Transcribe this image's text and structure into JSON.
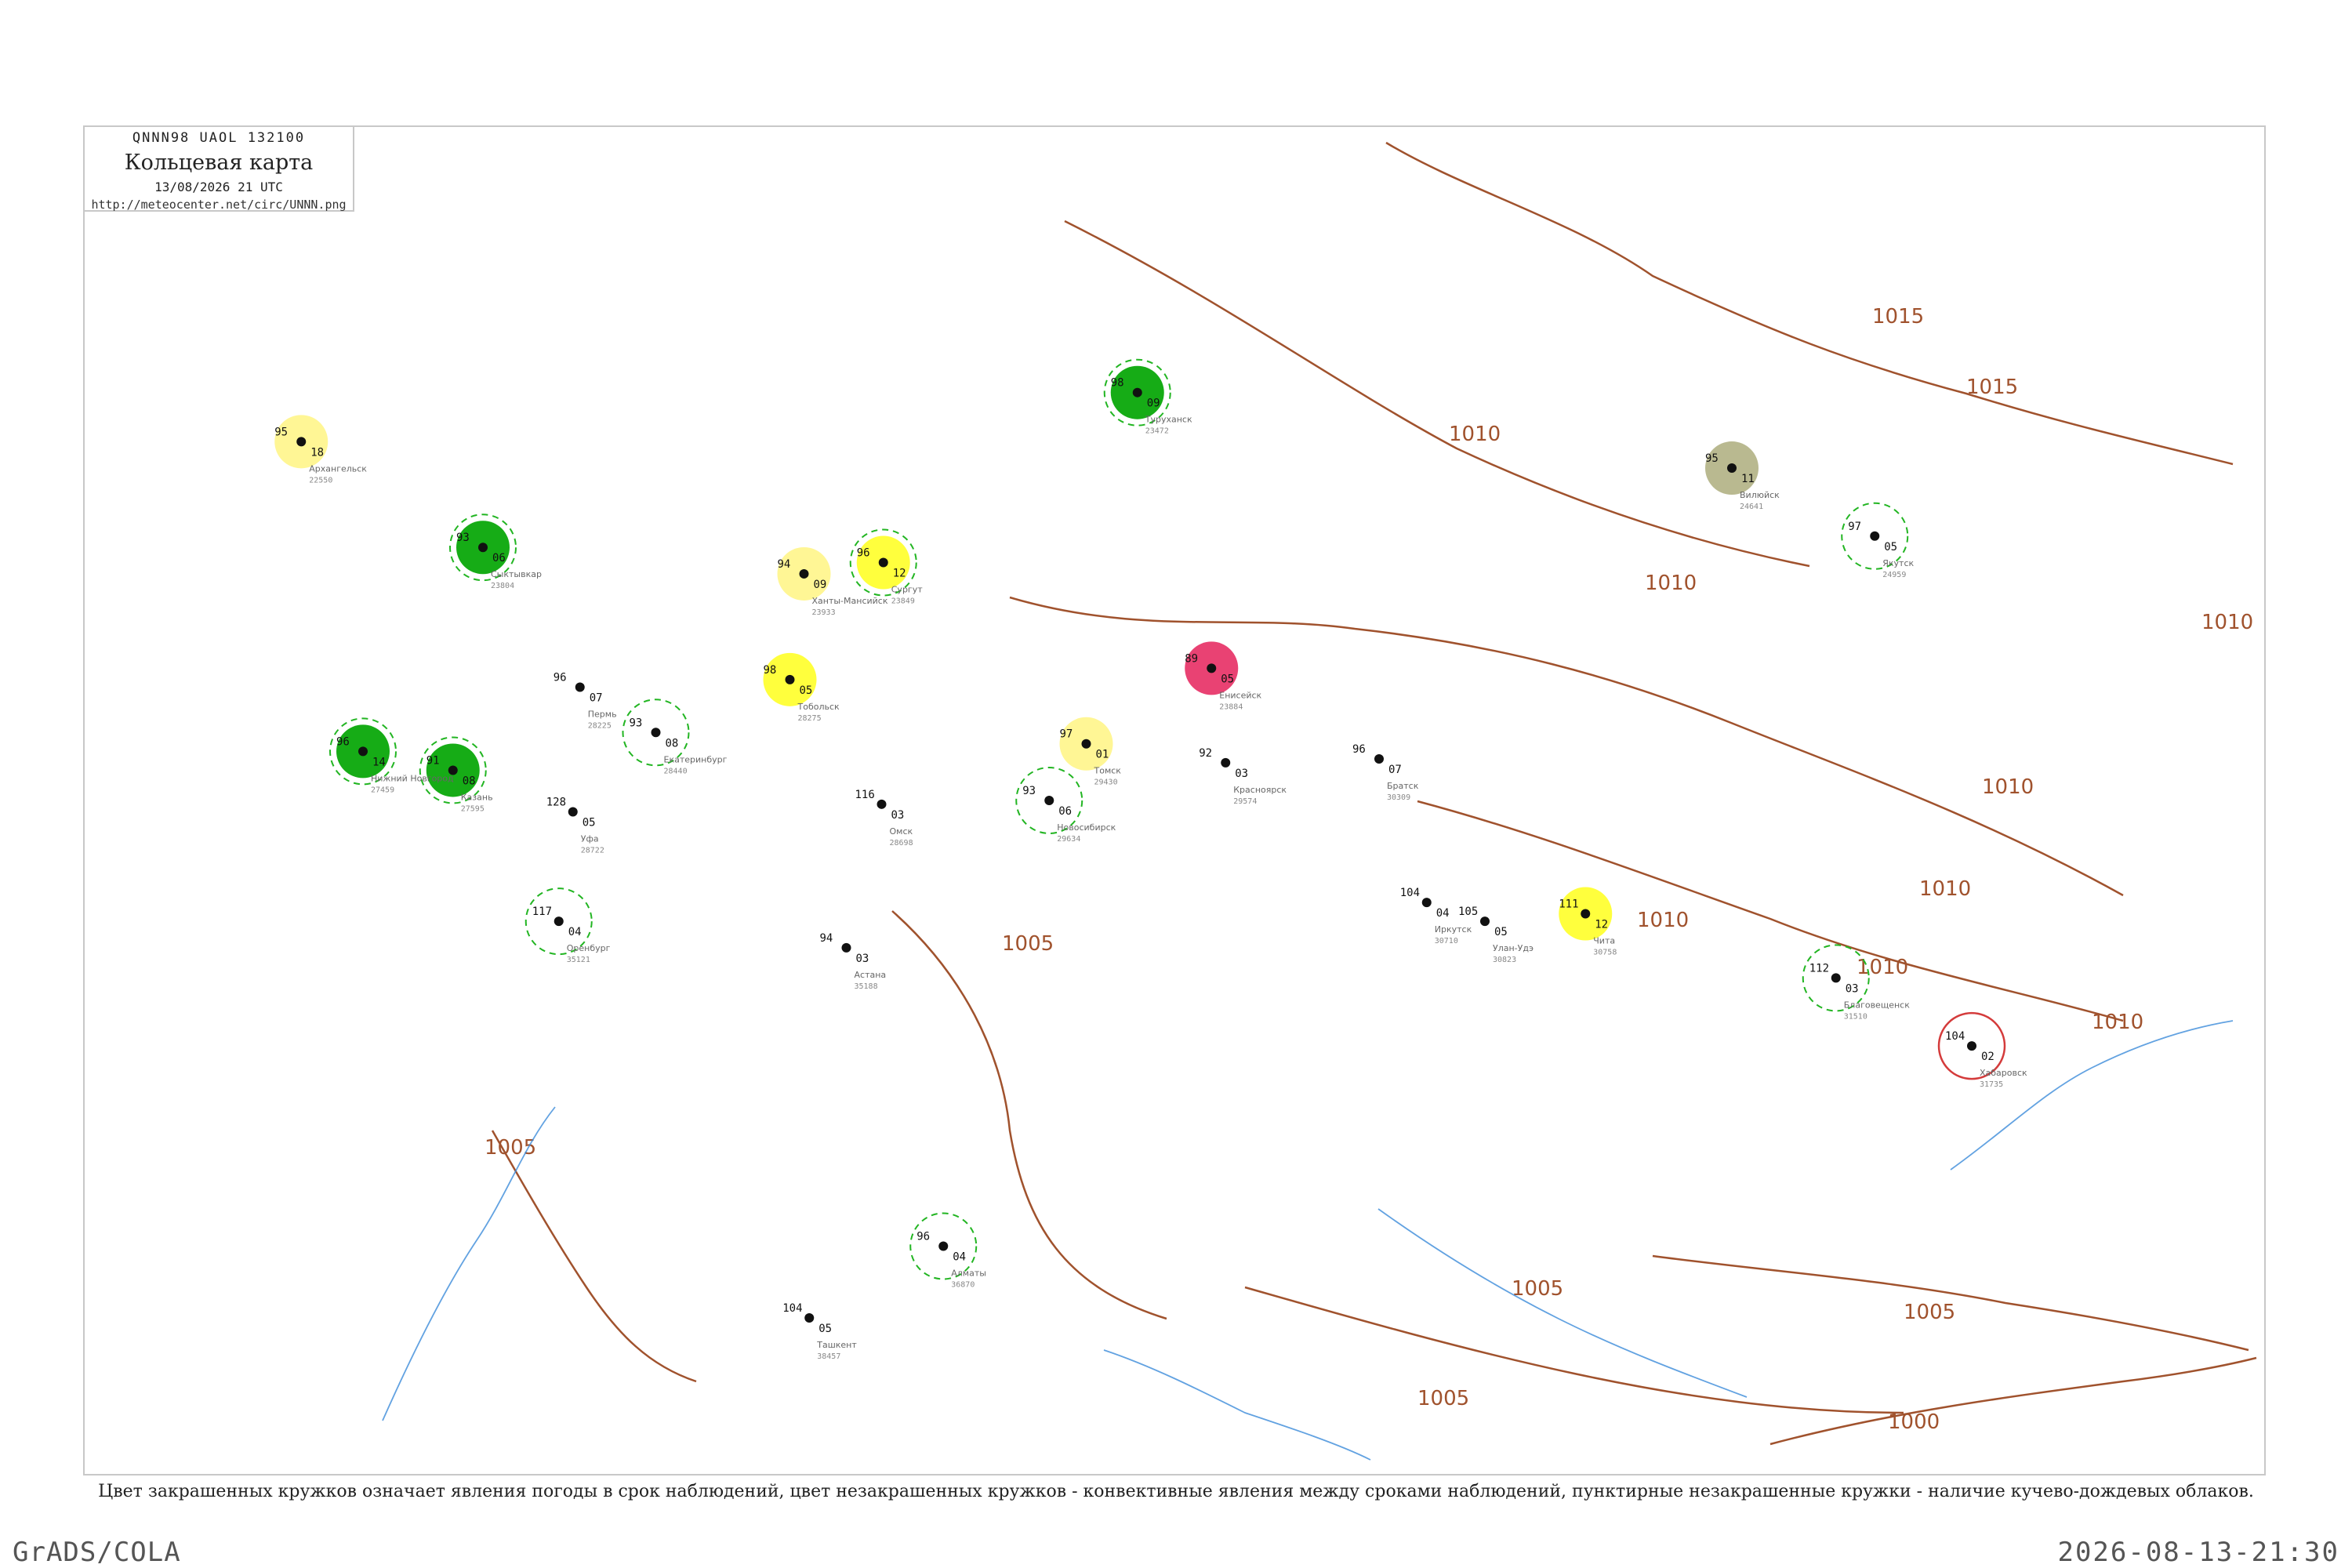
{
  "legend": {
    "code": "QNNN98  UAOL  132100",
    "title": "Кольцевая карта",
    "datetime": "13/08/2026 21 UTC",
    "url": "http://meteocenter.net/circ/UNNN.png"
  },
  "footnote": "Цвет закрашенных кружков означает явления погоды в срок наблюдений, цвет незакрашенных кружков - конвективные явления между сроками наблюдений, пунктирные незакрашенные кружки - наличие кучево-дождевых облаков.",
  "footer": {
    "producer": "GrADS/COLA",
    "timestamp": "2026-08-13-21:30"
  },
  "colors": {
    "isobar": "#a0522d",
    "water": "#3b8bd9",
    "green": "#0aa80a",
    "yellow": "#ffff33",
    "pale_yellow": "#fff68f",
    "pink": "#e8386b",
    "olive": "#b5b58a",
    "dashed_ring": "#22b522",
    "red_ring": "#d43b3b"
  },
  "isobar_labels": [
    "1015",
    "1015",
    "1010",
    "1010",
    "1010",
    "1010",
    "1010",
    "1010",
    "1010",
    "1010",
    "1005",
    "1005",
    "1005",
    "1005",
    "1005",
    "1000"
  ],
  "stations": [
    {
      "name": "Туруханск",
      "id": "23472",
      "lat": 65.8,
      "lon": 87.9,
      "temp": "98",
      "dew": "09",
      "fill": "green",
      "ring": "dashed"
    },
    {
      "name": "Ханты-Мансийск",
      "id": "23933",
      "lat": 61.0,
      "lon": 69.0,
      "temp": "94",
      "dew": "09",
      "fill": "pale_yellow",
      "ring": "none"
    },
    {
      "name": "Сургут",
      "id": "23849",
      "lat": 61.3,
      "lon": 73.5,
      "temp": "96",
      "dew": "12",
      "fill": "yellow",
      "ring": "dashed"
    },
    {
      "name": "Енисейск",
      "id": "23884",
      "lat": 58.5,
      "lon": 92.1,
      "temp": "89",
      "dew": "05",
      "fill": "pink",
      "ring": "none"
    },
    {
      "name": "Вилюйск",
      "id": "24641",
      "lat": 63.8,
      "lon": 121.6,
      "temp": "95",
      "dew": "11",
      "fill": "olive",
      "ring": "none"
    },
    {
      "name": "Якутск",
      "id": "24959",
      "lat": 62.0,
      "lon": 129.7,
      "temp": "97",
      "dew": "05",
      "fill": "none",
      "ring": "dashed"
    },
    {
      "name": "Чита",
      "id": "30758",
      "lat": 52.0,
      "lon": 113.3,
      "temp": "111",
      "dew": "12",
      "fill": "yellow",
      "ring": "none"
    },
    {
      "name": "Хабаровск",
      "id": "31735",
      "lat": 48.5,
      "lon": 135.2,
      "temp": "104",
      "dew": "02",
      "fill": "none",
      "ring": "red"
    },
    {
      "name": "Томск",
      "id": "29430",
      "lat": 56.5,
      "lon": 85.0,
      "temp": "97",
      "dew": "01",
      "fill": "pale_yellow",
      "ring": "none"
    },
    {
      "name": "Новосибирск",
      "id": "29634",
      "lat": 55.0,
      "lon": 82.9,
      "temp": "93",
      "dew": "06",
      "fill": "none",
      "ring": "dashed"
    },
    {
      "name": "Омск",
      "id": "28698",
      "lat": 54.9,
      "lon": 73.4,
      "temp": "116",
      "dew": "03",
      "fill": "none",
      "ring": "none"
    },
    {
      "name": "Тобольск",
      "id": "28275",
      "lat": 58.2,
      "lon": 68.2,
      "temp": "98",
      "dew": "05",
      "fill": "yellow",
      "ring": "none"
    },
    {
      "name": "Пермь",
      "id": "28225",
      "lat": 58.0,
      "lon": 56.3,
      "temp": "96",
      "dew": "07",
      "fill": "none",
      "ring": "none"
    },
    {
      "name": "Екатеринбург",
      "id": "28440",
      "lat": 56.8,
      "lon": 60.6,
      "temp": "93",
      "dew": "08",
      "fill": "none",
      "ring": "dashed"
    },
    {
      "name": "Уфа",
      "id": "28722",
      "lat": 54.7,
      "lon": 55.9,
      "temp": "128",
      "dew": "05",
      "fill": "none",
      "ring": "none"
    },
    {
      "name": "Казань",
      "id": "27595",
      "lat": 55.8,
      "lon": 49.1,
      "temp": "91",
      "dew": "08",
      "fill": "green",
      "ring": "dashed"
    },
    {
      "name": "Нижний Новгород",
      "id": "27459",
      "lat": 56.3,
      "lon": 44.0,
      "temp": "96",
      "dew": "14",
      "fill": "green",
      "ring": "dashed"
    },
    {
      "name": "Сыктывкар",
      "id": "23804",
      "lat": 61.7,
      "lon": 50.8,
      "temp": "93",
      "dew": "06",
      "fill": "green",
      "ring": "dashed"
    },
    {
      "name": "Архангельск",
      "id": "22550",
      "lat": 64.5,
      "lon": 40.5,
      "temp": "95",
      "dew": "18",
      "fill": "pale_yellow",
      "ring": "none"
    },
    {
      "name": "Оренбург",
      "id": "35121",
      "lat": 51.8,
      "lon": 55.1,
      "temp": "117",
      "dew": "04",
      "fill": "none",
      "ring": "dashed"
    },
    {
      "name": "Астана",
      "id": "35188",
      "lat": 51.1,
      "lon": 71.4,
      "temp": "94",
      "dew": "03",
      "fill": "none",
      "ring": "none"
    },
    {
      "name": "Алматы",
      "id": "36870",
      "lat": 43.2,
      "lon": 76.9,
      "temp": "96",
      "dew": "04",
      "fill": "none",
      "ring": "dashed"
    },
    {
      "name": "Ташкент",
      "id": "38457",
      "lat": 41.3,
      "lon": 69.3,
      "temp": "104",
      "dew": "05",
      "fill": "none",
      "ring": "none"
    },
    {
      "name": "Иркутск",
      "id": "30710",
      "lat": 52.3,
      "lon": 104.3,
      "temp": "104",
      "dew": "04",
      "fill": "none",
      "ring": "none"
    },
    {
      "name": "Красноярск",
      "id": "29574",
      "lat": 56.0,
      "lon": 92.9,
      "temp": "92",
      "dew": "03",
      "fill": "none",
      "ring": "none"
    },
    {
      "name": "Братск",
      "id": "30309",
      "lat": 56.1,
      "lon": 101.6,
      "temp": "96",
      "dew": "07",
      "fill": "none",
      "ring": "none"
    },
    {
      "name": "Улан-Удэ",
      "id": "30823",
      "lat": 51.8,
      "lon": 107.6,
      "temp": "105",
      "dew": "05",
      "fill": "none",
      "ring": "none"
    },
    {
      "name": "Благовещенск",
      "id": "31510",
      "lat": 50.3,
      "lon": 127.5,
      "temp": "112",
      "dew": "03",
      "fill": "none",
      "ring": "dashed"
    }
  ]
}
